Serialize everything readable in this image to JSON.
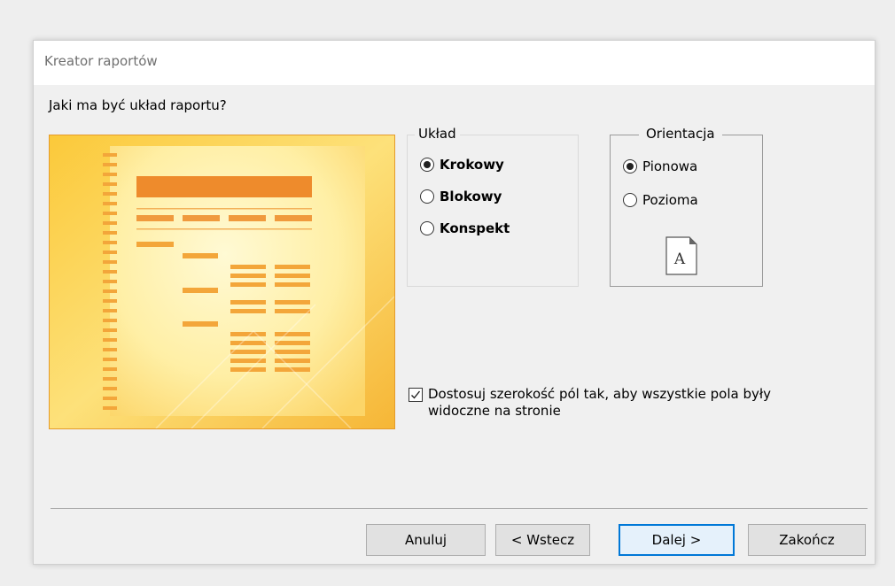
{
  "window": {
    "title": "Kreator raportów"
  },
  "question": "Jaki ma być układ raportu?",
  "layout_group": {
    "legend": "Układ",
    "options": [
      {
        "label": "Krokowy",
        "selected": true
      },
      {
        "label": "Blokowy",
        "selected": false
      },
      {
        "label": "Konspekt",
        "selected": false
      }
    ]
  },
  "orientation_group": {
    "legend": "Orientacja",
    "options": [
      {
        "label": "Pionowa",
        "selected": true
      },
      {
        "label": "Pozioma",
        "selected": false
      }
    ],
    "page_icon_letter": "A"
  },
  "fit_fields": {
    "checked": true,
    "label": "Dostosuj szerokość pól tak, aby wszystkie pola były widoczne na stronie"
  },
  "buttons": {
    "cancel": "Anuluj",
    "back": "< Wstecz",
    "next": "Dalej >",
    "finish": "Zakończ"
  },
  "colors": {
    "preview_border": "#e59b2b",
    "preview_bar": "#ee8b2c",
    "primary_button_border": "#0078d7"
  },
  "icons": {
    "page_orientation": "portrait-page-icon",
    "checkbox_check": "checkmark-icon",
    "preview": "report-layout-preview-icon"
  }
}
